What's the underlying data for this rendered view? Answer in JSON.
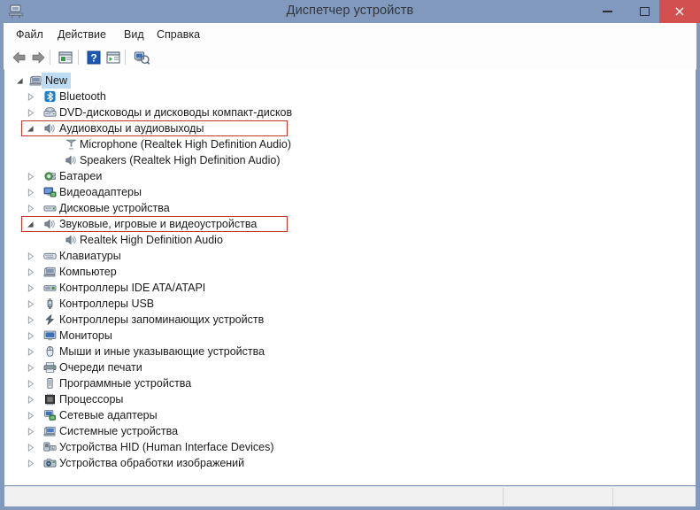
{
  "window": {
    "title": "Диспетчер устройств",
    "app_icon": "device-manager-icon",
    "minimize_label": "–",
    "maximize_label": "□",
    "close_label": "×",
    "titlebar_color": "#8099bd",
    "close_button_color": "#d2504f"
  },
  "menubar": {
    "items": [
      {
        "label": "Файл",
        "name": "menu-file"
      },
      {
        "label": "Действие",
        "name": "menu-action"
      },
      {
        "label": "Вид",
        "name": "menu-view"
      },
      {
        "label": "Справка",
        "name": "menu-help"
      }
    ]
  },
  "toolbar": {
    "buttons": [
      {
        "name": "back-arrow-icon",
        "title": "Назад"
      },
      {
        "name": "forward-arrow-icon",
        "title": "Вперед"
      },
      {
        "name": "properties-icon",
        "title": "Свойства"
      },
      {
        "name": "help-question-icon",
        "title": "Справка"
      },
      {
        "name": "update-driver-icon",
        "title": "Обновить конфигурацию оборудования"
      },
      {
        "name": "scan-hardware-icon",
        "title": "Сканировать"
      }
    ]
  },
  "tree": {
    "selected_item": "New",
    "highlight_color": "#c0392b",
    "selection_color": "#bcdcf4",
    "items": [
      {
        "label": "New",
        "level": 0,
        "expander": "expanded",
        "icon": "computer-icon",
        "selected": true,
        "highlight": false
      },
      {
        "label": "Bluetooth",
        "level": 1,
        "expander": "collapsed",
        "icon": "bluetooth-icon",
        "selected": false,
        "highlight": false
      },
      {
        "label": "DVD-дисководы и дисководы компакт-дисков",
        "level": 1,
        "expander": "collapsed",
        "icon": "dvd-drive-icon",
        "selected": false,
        "highlight": false
      },
      {
        "label": "Аудиовходы и аудиовыходы",
        "level": 1,
        "expander": "expanded",
        "icon": "speaker-icon",
        "selected": false,
        "highlight": true,
        "highlight_width": 301
      },
      {
        "label": "Microphone (Realtek High Definition Audio)",
        "level": 2,
        "expander": "none",
        "icon": "microphone-icon",
        "selected": false,
        "highlight": false
      },
      {
        "label": "Speakers (Realtek High Definition Audio)",
        "level": 2,
        "expander": "none",
        "icon": "speaker-icon",
        "selected": false,
        "highlight": false
      },
      {
        "label": "Батареи",
        "level": 1,
        "expander": "collapsed",
        "icon": "battery-icon",
        "selected": false,
        "highlight": false
      },
      {
        "label": "Видеоадаптеры",
        "level": 1,
        "expander": "collapsed",
        "icon": "display-adapter-icon",
        "selected": false,
        "highlight": false
      },
      {
        "label": "Дисковые устройства",
        "level": 1,
        "expander": "collapsed",
        "icon": "disk-drive-icon",
        "selected": false,
        "highlight": false
      },
      {
        "label": "Звуковые, игровые и видеоустройства",
        "level": 1,
        "expander": "expanded",
        "icon": "speaker-icon",
        "selected": false,
        "highlight": true,
        "highlight_width": 301
      },
      {
        "label": "Realtek High Definition Audio",
        "level": 2,
        "expander": "none",
        "icon": "speaker-icon",
        "selected": false,
        "highlight": false
      },
      {
        "label": "Клавиатуры",
        "level": 1,
        "expander": "collapsed",
        "icon": "keyboard-icon",
        "selected": false,
        "highlight": false
      },
      {
        "label": "Компьютер",
        "level": 1,
        "expander": "collapsed",
        "icon": "computer-icon",
        "selected": false,
        "highlight": false
      },
      {
        "label": "Контроллеры IDE ATA/ATAPI",
        "level": 1,
        "expander": "collapsed",
        "icon": "ide-controller-icon",
        "selected": false,
        "highlight": false
      },
      {
        "label": "Контроллеры USB",
        "level": 1,
        "expander": "collapsed",
        "icon": "usb-icon",
        "selected": false,
        "highlight": false
      },
      {
        "label": "Контроллеры запоминающих устройств",
        "level": 1,
        "expander": "collapsed",
        "icon": "storage-controller-icon",
        "selected": false,
        "highlight": false
      },
      {
        "label": "Мониторы",
        "level": 1,
        "expander": "collapsed",
        "icon": "monitor-icon",
        "selected": false,
        "highlight": false
      },
      {
        "label": "Мыши и иные указывающие устройства",
        "level": 1,
        "expander": "collapsed",
        "icon": "mouse-icon",
        "selected": false,
        "highlight": false
      },
      {
        "label": "Очереди печати",
        "level": 1,
        "expander": "collapsed",
        "icon": "printer-icon",
        "selected": false,
        "highlight": false
      },
      {
        "label": "Программные устройства",
        "level": 1,
        "expander": "collapsed",
        "icon": "software-device-icon",
        "selected": false,
        "highlight": false
      },
      {
        "label": "Процессоры",
        "level": 1,
        "expander": "collapsed",
        "icon": "processor-icon",
        "selected": false,
        "highlight": false
      },
      {
        "label": "Сетевые адаптеры",
        "level": 1,
        "expander": "collapsed",
        "icon": "network-adapter-icon",
        "selected": false,
        "highlight": false
      },
      {
        "label": "Системные устройства",
        "level": 1,
        "expander": "collapsed",
        "icon": "system-device-icon",
        "selected": false,
        "highlight": false
      },
      {
        "label": "Устройства HID (Human Interface Devices)",
        "level": 1,
        "expander": "collapsed",
        "icon": "hid-device-icon",
        "selected": false,
        "highlight": false
      },
      {
        "label": "Устройства обработки изображений",
        "level": 1,
        "expander": "collapsed",
        "icon": "imaging-device-icon",
        "selected": false,
        "highlight": false
      }
    ]
  },
  "statusbar": {
    "panes": [
      {
        "text": "",
        "name": "status-pane-main"
      },
      {
        "text": "",
        "name": "status-pane-second"
      },
      {
        "text": "",
        "name": "status-pane-third"
      }
    ]
  }
}
